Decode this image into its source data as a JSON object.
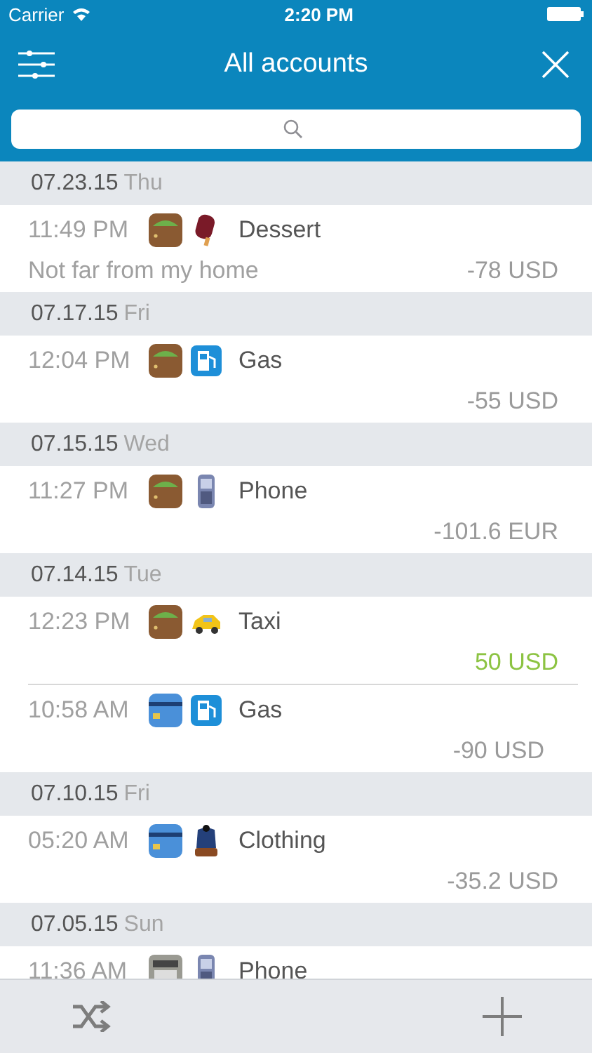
{
  "status_bar": {
    "carrier": "Carrier",
    "time": "2:20 PM"
  },
  "nav": {
    "title": "All accounts"
  },
  "days": [
    {
      "date": "07.23.15",
      "weekday": "Thu",
      "entries": [
        {
          "time": "11:49 PM",
          "icons": [
            {
              "kind": "wallet"
            },
            {
              "kind": "dessert"
            }
          ],
          "name": "Dessert",
          "note": "Not far from my home",
          "amount": "-78 USD",
          "income": false
        }
      ]
    },
    {
      "date": "07.17.15",
      "weekday": "Fri",
      "entries": [
        {
          "time": "12:04 PM",
          "icons": [
            {
              "kind": "wallet"
            },
            {
              "kind": "fuel"
            }
          ],
          "name": "Gas",
          "amount": "-55 USD",
          "income": false
        }
      ]
    },
    {
      "date": "07.15.15",
      "weekday": "Wed",
      "entries": [
        {
          "time": "11:27 PM",
          "icons": [
            {
              "kind": "wallet"
            },
            {
              "kind": "phone"
            }
          ],
          "name": "Phone",
          "amount": "-101.6 EUR",
          "income": false
        }
      ]
    },
    {
      "date": "07.14.15",
      "weekday": "Tue",
      "entries": [
        {
          "time": "12:23 PM",
          "icons": [
            {
              "kind": "wallet"
            },
            {
              "kind": "taxi"
            }
          ],
          "name": "Taxi",
          "amount": "50 USD",
          "income": true
        },
        {
          "time": "10:58 AM",
          "icons": [
            {
              "kind": "card"
            },
            {
              "kind": "fuel"
            }
          ],
          "name": "Gas",
          "amount": "-90 USD",
          "income": false
        }
      ]
    },
    {
      "date": "07.10.15",
      "weekday": "Fri",
      "entries": [
        {
          "time": "05:20 AM",
          "icons": [
            {
              "kind": "card"
            },
            {
              "kind": "clothing"
            }
          ],
          "name": "Clothing",
          "amount": "-35.2 USD",
          "income": false
        }
      ]
    },
    {
      "date": "07.05.15",
      "weekday": "Sun",
      "entries": [
        {
          "time": "11:36 AM",
          "icons": [
            {
              "kind": "register"
            },
            {
              "kind": "phone"
            }
          ],
          "name": "Phone"
        }
      ]
    }
  ]
}
